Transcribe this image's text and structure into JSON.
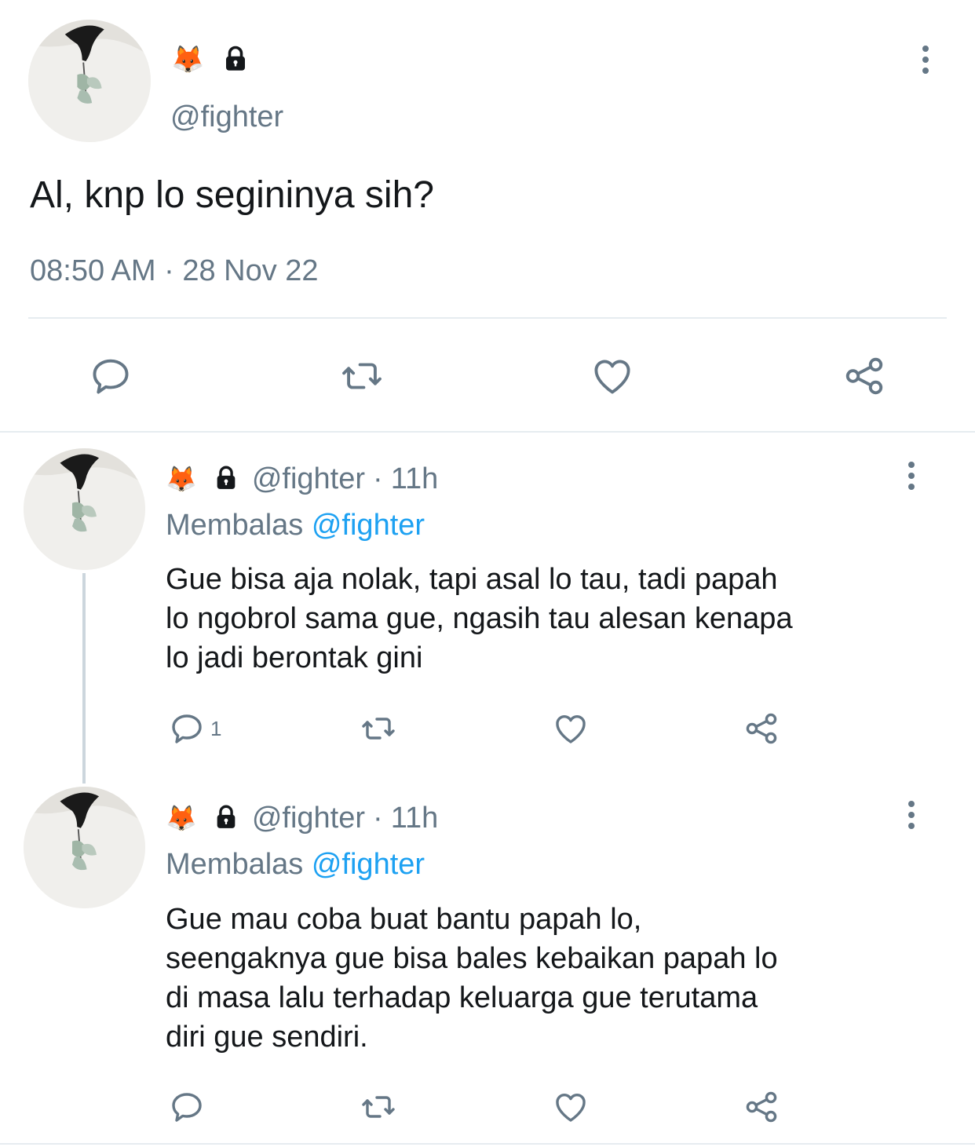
{
  "main_tweet": {
    "emoji": "🦊",
    "handle": "@fighter",
    "text": "Al, knp lo segininya sih?",
    "timestamp": "08:50 AM · 28 Nov 22",
    "actions": [
      "reply-icon",
      "retweet-icon",
      "like-icon",
      "share-icon"
    ]
  },
  "replies": [
    {
      "emoji": "🦊",
      "handle": "@fighter",
      "time": "11h",
      "replying_prefix": "Membalas",
      "replying_to": "@fighter",
      "text_lines": [
        "Gue bisa aja nolak, tapi asal lo tau, tadi papah",
        "lo ngobrol sama gue, ngasih tau alesan kenapa",
        "lo jadi berontak gini"
      ],
      "reply_count": "1"
    },
    {
      "emoji": "🦊",
      "handle": "@fighter",
      "time": "11h",
      "replying_prefix": "Membalas",
      "replying_to": "@fighter",
      "text_lines": [
        "Gue mau coba buat bantu papah lo,",
        "seengaknya gue bisa bales kebaikan papah lo",
        "di masa lalu terhadap keluarga gue terutama",
        "diri gue sendiri."
      ],
      "reply_count": ""
    }
  ],
  "colors": {
    "text": "#14171a",
    "secondary": "#657786",
    "link": "#1da1f2",
    "divider": "#e6ecf0",
    "thread_line": "#ccd6dd"
  }
}
